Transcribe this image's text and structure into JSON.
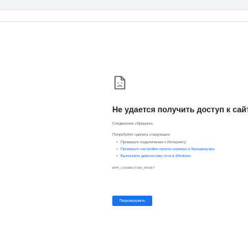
{
  "error": {
    "title": "Не удается получить доступ к сайту",
    "message": "Соединение сброшено.",
    "try_heading": "Попробуйте сделать следующее:",
    "suggestions": [
      {
        "text": "Проверьте подключение к Интернету.",
        "is_link": false
      },
      {
        "text": "Проверьте настройки прокси-сервера и брандмауэра",
        "is_link": true
      },
      {
        "text": "Выполните диагностику сети в Windows",
        "is_link": true
      }
    ],
    "code": "ERR_CONNECTION_RESET",
    "reload_label": "Перезагрузить",
    "icon": "sad-document-icon"
  },
  "colors": {
    "accent": "#1a73e8",
    "title": "#202124",
    "text": "#5f6368"
  }
}
